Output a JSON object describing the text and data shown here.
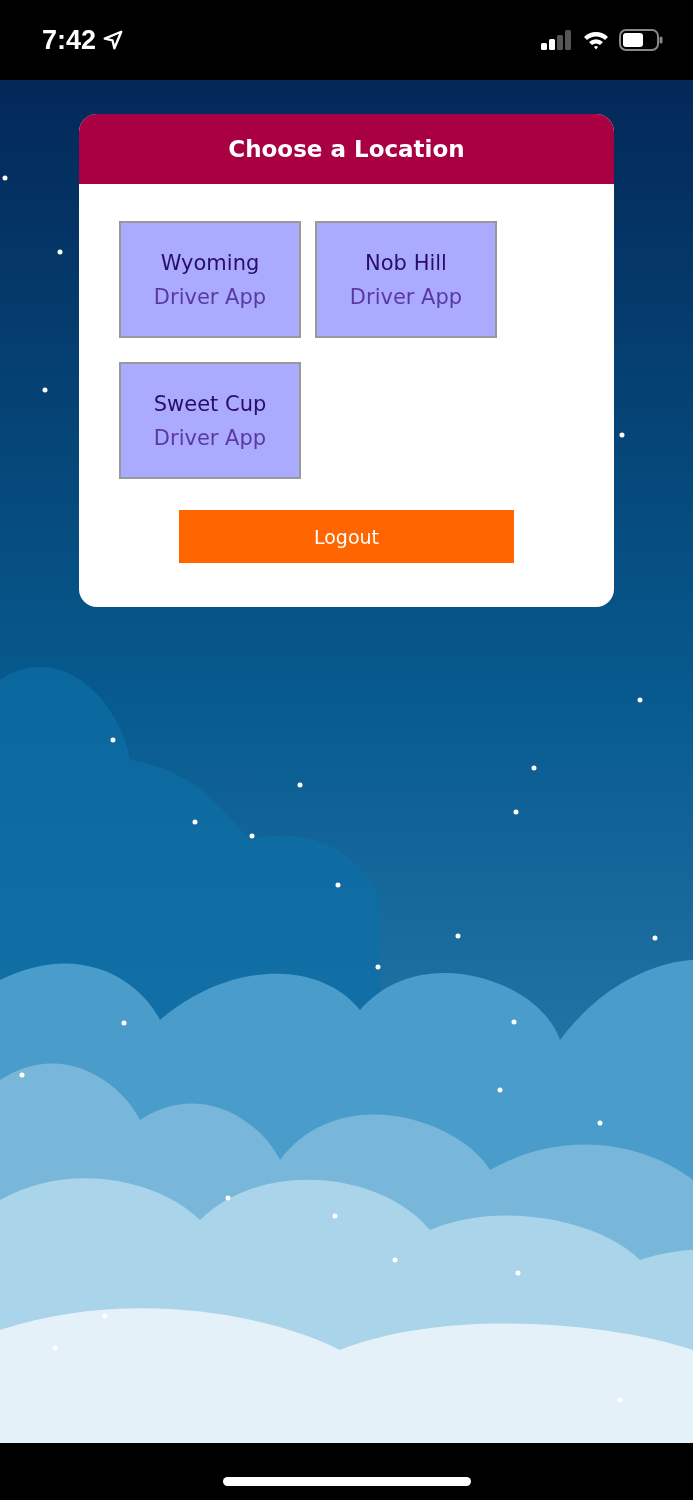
{
  "status_bar": {
    "time": "7:42"
  },
  "card": {
    "title": "Choose a Location",
    "locations": [
      {
        "name": "Wyoming",
        "subtitle": "Driver App"
      },
      {
        "name": "Nob Hill",
        "subtitle": "Driver App"
      },
      {
        "name": "Sweet Cup",
        "subtitle": "Driver App"
      }
    ],
    "logout_button": "Logout"
  }
}
